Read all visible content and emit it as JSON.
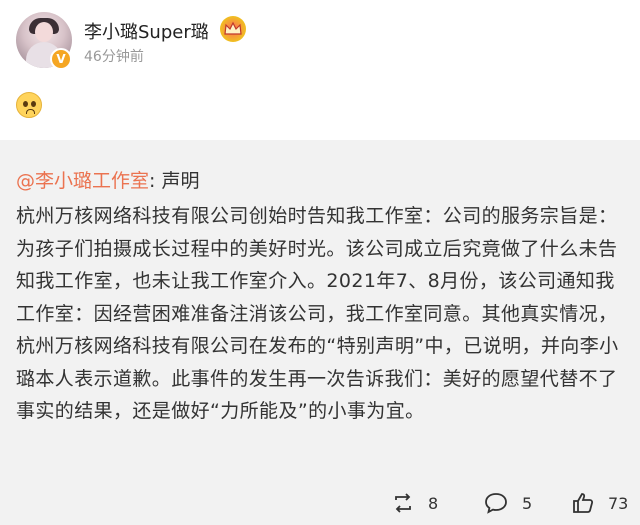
{
  "post": {
    "username": "李小璐Super璐",
    "timestamp": "46分钟前",
    "verified_badge": "V",
    "emoji_icon": "pleading-face-icon",
    "crown_icon": "crown-icon"
  },
  "repost": {
    "mention": "@李小璐工作室",
    "title_suffix": ": 声明",
    "body": "杭州万核网络科技有限公司创始时告知我工作室：公司的服务宗旨是：为孩子们拍摄成长过程中的美好时光。该公司成立后究竟做了什么未告知我工作室，也未让我工作室介入。2021年7、8月份，该公司通知我工作室：因经营困难准备注消该公司，我工作室同意。其他真实情况，杭州万核网络科技有限公司在发布的“特别声明”中，已说明，并向李小璐本人表示道歉。此事件的发生再一次告诉我们：美好的愿望代替不了事实的结果，还是做好“力所能及”的小事为宜。"
  },
  "actions": {
    "repost_count": "8",
    "comment_count": "5",
    "like_count": "73"
  },
  "colors": {
    "mention": "#eb7350",
    "repost_bg": "#f2f2f2",
    "badge": "#f5a623"
  }
}
